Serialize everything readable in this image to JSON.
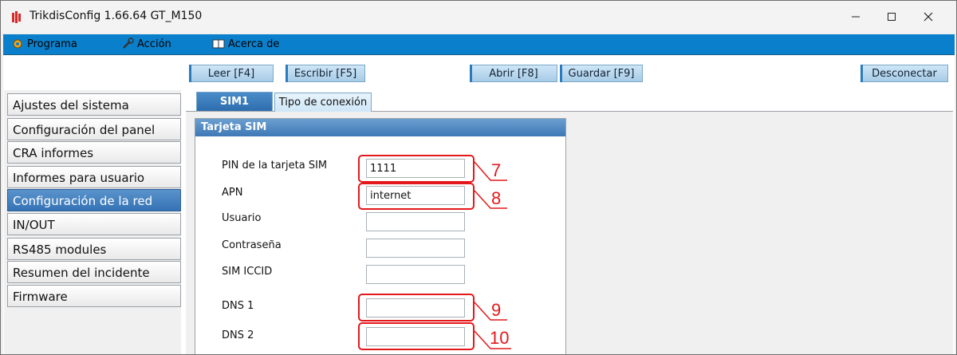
{
  "window": {
    "title": "TrikdisConfig 1.66.64   GT_M150"
  },
  "menu": [
    {
      "label": "Programa",
      "icon": "gear-icon"
    },
    {
      "label": "Acción",
      "icon": "wrench-icon"
    },
    {
      "label": "Acerca de",
      "icon": "book-icon"
    }
  ],
  "toolbar": {
    "read": "Leer [F4]",
    "write": "Escribir [F5]",
    "open": "Abrir [F8]",
    "save": "Guardar [F9]",
    "disconnect": "Desconectar"
  },
  "sidebar": {
    "items": [
      "Ajustes del sistema",
      "Configuración del panel",
      "CRA informes",
      "Informes para usuario",
      "Configuración de la red",
      "IN/OUT",
      "RS485 modules",
      "Resumen del incidente",
      "Firmware"
    ],
    "active_index": 4
  },
  "tabs": {
    "sim1": "SIM1",
    "tipo": "Tipo de conexión"
  },
  "sim_group": {
    "title": "Tarjeta SIM",
    "fields": {
      "pin": {
        "label": "PIN de la tarjeta SIM",
        "value": "1111"
      },
      "apn": {
        "label": "APN",
        "value": "internet"
      },
      "user": {
        "label": "Usuario",
        "value": ""
      },
      "password": {
        "label": "Contraseña",
        "value": ""
      },
      "iccid": {
        "label": "SIM ICCID",
        "value": ""
      },
      "dns1": {
        "label": "DNS 1",
        "value": ""
      },
      "dns2": {
        "label": "DNS 2",
        "value": ""
      }
    }
  },
  "callouts": {
    "c7": "7",
    "c8": "8",
    "c9": "9",
    "c10": "10"
  },
  "colors": {
    "menubar": "#0a80cc",
    "active_item": "#3573b5",
    "callout": "#e4181b"
  }
}
